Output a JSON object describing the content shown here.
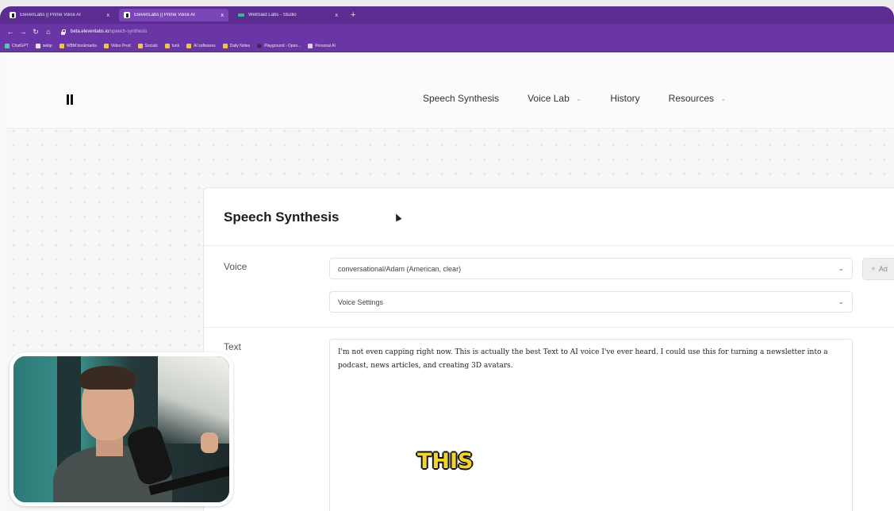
{
  "browser": {
    "tabs": [
      {
        "title": "ElevenLabs || Prime Voice AI",
        "active": false
      },
      {
        "title": "ElevenLabs || Prime Voice AI",
        "active": true
      },
      {
        "title": "WellSaid Labs - Studio",
        "active": false
      }
    ],
    "tab_close": "x",
    "new_tab": "+",
    "url_host": "beta.elevenlabs.io",
    "url_path": "/speech-synthesis",
    "bookmarks": [
      {
        "label": "ChatGPT",
        "icon": "teal"
      },
      {
        "label": "webp",
        "icon": "white"
      },
      {
        "label": "WBM bookmarks",
        "icon": "folder"
      },
      {
        "label": "Video Prod",
        "icon": "folder"
      },
      {
        "label": "Socials",
        "icon": "folder"
      },
      {
        "label": "funk",
        "icon": "folder"
      },
      {
        "label": "AI softwares",
        "icon": "folder"
      },
      {
        "label": "Daily Notes",
        "icon": "folder"
      },
      {
        "label": "Playground - Open...",
        "icon": "dark"
      },
      {
        "label": "Personal AI",
        "icon": "box"
      }
    ]
  },
  "header": {
    "nav": [
      {
        "label": "Speech Synthesis",
        "has_dropdown": false
      },
      {
        "label": "Voice Lab",
        "has_dropdown": true
      },
      {
        "label": "History",
        "has_dropdown": false
      },
      {
        "label": "Resources",
        "has_dropdown": true
      }
    ]
  },
  "card": {
    "title": "Speech Synthesis",
    "voice_label": "Voice",
    "voice_value": "conversational/Adam (American, clear)",
    "voice_settings": "Voice Settings",
    "add_button": "Ad",
    "text_label": "Text",
    "text_value": "I'm not even capping right now. This is actually the best Text to AI voice I've ever heard. I could use this for turning a newsletter into a podcast, news articles, and creating 3D avatars."
  },
  "caption": "THIS",
  "colors": {
    "browser_purple": "#6a36a6",
    "tab_purple": "#5b2d91",
    "caption_yellow": "#f4d42a"
  }
}
